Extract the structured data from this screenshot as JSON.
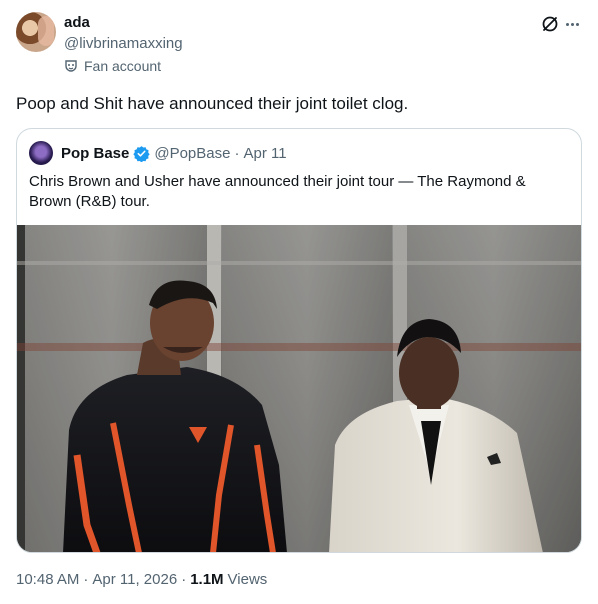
{
  "author": {
    "display_name": "ada",
    "handle": "@livbrinamaxxing",
    "label": "Fan account",
    "label_icon": "mask-icon"
  },
  "tweet": {
    "text": "Poop and Shit have announced their joint toilet clog."
  },
  "quote": {
    "display_name": "Pop Base",
    "verified": true,
    "handle": "@PopBase",
    "separator": "·",
    "date": "Apr 11",
    "text": "Chris Brown and Usher have announced their joint tour — The Raymond & Brown (R&B) tour.",
    "media_description_icon": "video-still"
  },
  "meta": {
    "time": "10:48 AM",
    "separator": "·",
    "date": "Apr 11, 2026",
    "separator2": "·",
    "views_count": "1.1M",
    "views_label": "Views"
  },
  "colors": {
    "text_primary": "#0f1419",
    "text_secondary": "#536471",
    "border": "#cfd9de",
    "verified_blue": "#1d9bf0"
  }
}
